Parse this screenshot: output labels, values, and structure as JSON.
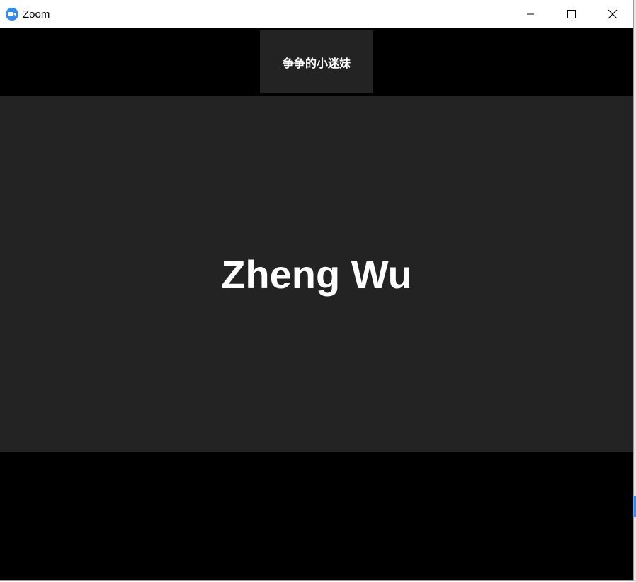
{
  "window": {
    "app_icon": "zoom-camera-icon",
    "title": "Zoom",
    "controls": {
      "minimize_icon": "minimize-icon",
      "maximize_icon": "maximize-icon",
      "close_icon": "close-icon"
    }
  },
  "gallery": {
    "thumbnail_name": "争争的小迷妹"
  },
  "active_speaker": {
    "name": "Zheng Wu"
  },
  "colors": {
    "brand": "#2d8cff",
    "video_bg": "#232323",
    "strip_bg": "#000000"
  }
}
